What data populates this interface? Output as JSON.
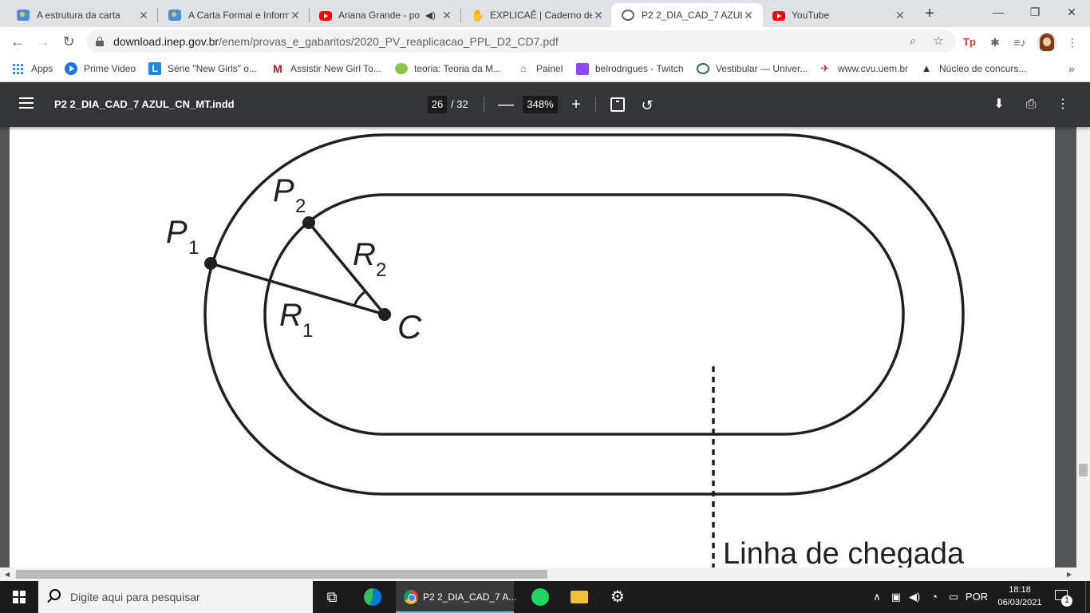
{
  "browser": {
    "tabs": [
      {
        "title": "A estrutura da carta",
        "icon": "app-favicon",
        "active": false
      },
      {
        "title": "A Carta Formal e Inform",
        "icon": "app-favicon",
        "active": false
      },
      {
        "title": "Ariana Grande - po",
        "icon": "youtube-icon",
        "active": false,
        "audio": true
      },
      {
        "title": "EXPLICAÊ | Caderno de",
        "icon": "hand-favicon",
        "active": false
      },
      {
        "title": "P2 2_DIA_CAD_7 AZUL",
        "icon": "globe-icon",
        "active": true
      },
      {
        "title": "YouTube",
        "icon": "youtube-icon",
        "active": false
      }
    ],
    "new_tab": "+",
    "window_controls": {
      "minimize": "—",
      "restore": "❐",
      "close": "✕"
    },
    "url_host": "download.inep.gov.br",
    "url_path": "/enem/provas_e_gabaritos/2020_PV_reaplicacao_PPL_D2_CD7.pdf",
    "nav": {
      "back": "←",
      "forward": "→",
      "reload": "↻"
    },
    "extensions": {
      "tp": "Tp",
      "puzzle": "✱",
      "media": "≡♪"
    },
    "bookmarks": [
      {
        "label": "Apps",
        "icon": "apps-grid-icon"
      },
      {
        "label": "Prime Video",
        "icon": "prime-video-icon"
      },
      {
        "label": "Série \"New Girls\" o...",
        "icon": "letter-l-icon"
      },
      {
        "label": "Assistir New Girl To...",
        "icon": "letter-m-icon"
      },
      {
        "label": "teoria: Teoria da M...",
        "icon": "music-note-icon"
      },
      {
        "label": "Painel",
        "icon": "house-icon"
      },
      {
        "label": "belrodrigues - Twitch",
        "icon": "twitch-icon"
      },
      {
        "label": "Vestibular — Univer...",
        "icon": "ring-icon"
      },
      {
        "label": "www.cvu.uem.br",
        "icon": "uem-icon"
      },
      {
        "label": "Núcleo de concurs...",
        "icon": "hat-icon"
      }
    ],
    "bookmarks_more": "»"
  },
  "pdf_viewer": {
    "document_title": "P2 2_DIA_CAD_7 AZUL_CN_MT.indd",
    "current_page": "26",
    "total_pages": "/ 32",
    "zoom": "348%",
    "zoom_out": "—",
    "zoom_in": "+",
    "rotate": "↺",
    "download": "⬇",
    "print": "⎙",
    "more": "⋮"
  },
  "figure": {
    "point_p1": "P",
    "point_p1_sub": "1",
    "point_p2": "P",
    "point_p2_sub": "2",
    "radius_r1": "R",
    "radius_r1_sub": "1",
    "radius_r2": "R",
    "radius_r2_sub": "2",
    "center": "C",
    "finish_line_label": "Linha de chegada"
  },
  "taskbar": {
    "search_placeholder": "Digite aqui para pesquisar",
    "active_app_label": "P2 2_DIA_CAD_7 A...",
    "language": "POR",
    "time": "18:18",
    "date": "06/03/2021",
    "notifications": "1"
  },
  "colors": {
    "pdf_toolbar": "#323639",
    "viewer_background": "#525659",
    "figure_ink": "#231f20",
    "taskbar": "#1c1c1c"
  }
}
